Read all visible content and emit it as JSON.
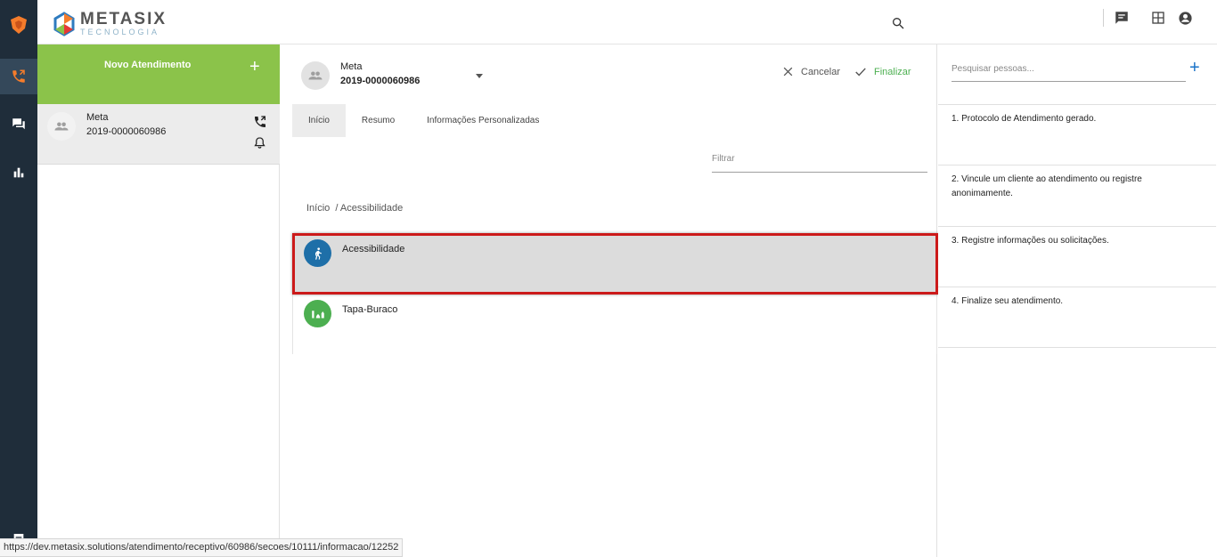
{
  "brand": {
    "name": "METASIX",
    "tagline": "TECNOLOGIA"
  },
  "new_call": {
    "label": "Novo Atendimento",
    "plus": "+"
  },
  "call_card": {
    "name": "Meta",
    "number": "2019-0000060986"
  },
  "selected": {
    "name": "Meta",
    "number": "2019-0000060986"
  },
  "actions": {
    "cancel": "Cancelar",
    "finalize": "Finalizar"
  },
  "tabs": [
    {
      "label": "Início",
      "active": true
    },
    {
      "label": "Resumo",
      "active": false
    },
    {
      "label": "Informações Personalizadas",
      "active": false
    }
  ],
  "filter": {
    "placeholder": "Filtrar"
  },
  "breadcrumb": "Início  / Acessibilidade",
  "categories": [
    {
      "label": "Acessibilidade",
      "icon": "walking-person-icon",
      "color": "#1e6fa8"
    },
    {
      "label": "Tapa-Buraco",
      "icon": "roadwork-icon",
      "color": "#4caf50"
    }
  ],
  "search_people": {
    "placeholder": "Pesquisar pessoas...",
    "add": "+"
  },
  "steps": [
    "1. Protocolo de Atendimento gerado.",
    "2. Vincule um cliente ao atendimento ou registre anonimamente.",
    "3. Registre informações ou solicitações.",
    "4. Finalize seu atendimento."
  ],
  "status_url": "https://dev.metasix.solutions/atendimento/receptivo/60986/secoes/10111/informacao/12252",
  "colors": {
    "rail": "#1f2d3a",
    "accent_green": "#8bc34a",
    "orange": "#f57c2b",
    "highlight_red": "#cc1a1a"
  }
}
